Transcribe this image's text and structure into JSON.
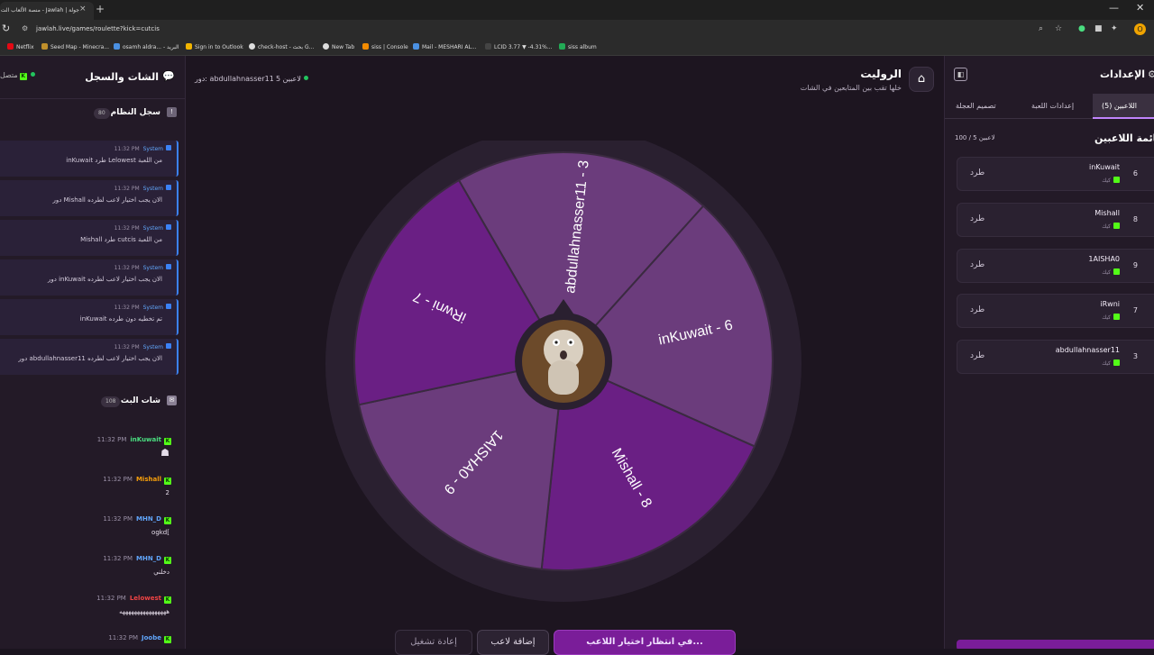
{
  "browser": {
    "tab_title": "جولة | Jawlah - منصة الألعاب الت",
    "tab_close": "×",
    "new_tab": "+",
    "url": "jawlah.live/games/roulette?kick=cutcis",
    "bookmarks": [
      {
        "label": "Netflix",
        "color": "#e50914"
      },
      {
        "label": "Seed Map - Minecra...",
        "color": "#c0902b"
      },
      {
        "label": "osamh aldra... - البريد",
        "color": "#4a90e2"
      },
      {
        "label": "Sign in to Outlook",
        "color": "#f2b500"
      },
      {
        "label": "check-host - بحث G...",
        "color": "#dddddd"
      },
      {
        "label": "New Tab",
        "color": "#dddddd"
      },
      {
        "label": "siss | Console",
        "color": "#f28b00"
      },
      {
        "label": "Mail - MESHARI AL...",
        "color": "#4a90e2"
      },
      {
        "label": "LCID 3.77 ▼ -4.31%...",
        "color": "#444444"
      },
      {
        "label": "siss album",
        "color": "#22aa55"
      }
    ],
    "avatar_letter": "O"
  },
  "chat_panel": {
    "title": "الشات والسجل",
    "status": "متصل",
    "system_log": {
      "title": "سجل النظام",
      "count": "80",
      "messages": [
        {
          "time": "11:32 PM",
          "sender": "System",
          "text": "inKuwait طرد Lelowest من اللعبة"
        },
        {
          "time": "11:32 PM",
          "sender": "System",
          "text": "دور Mishall الان يجب اختيار لاعب لطرده"
        },
        {
          "time": "11:32 PM",
          "sender": "System",
          "text": "Mishall طرد cutcis من اللعبة"
        },
        {
          "time": "11:32 PM",
          "sender": "System",
          "text": "دور inKuwait الان يجب اختيار لاعب لطرده"
        },
        {
          "time": "11:32 PM",
          "sender": "System",
          "text": "inKuwait تم تخطيه دون طرده"
        },
        {
          "time": "11:32 PM",
          "sender": "System",
          "text": "دور abdullahnasser11 الان يجب اختيار لاعب لطرده"
        }
      ]
    },
    "live_chat": {
      "title": "شات البث",
      "count": "108",
      "messages": [
        {
          "time": "11:32 PM",
          "user": "inKuwait",
          "color": "#4ade80",
          "text": "☗"
        },
        {
          "time": "11:32 PM",
          "user": "Mishall",
          "color": "#f59e0b",
          "text": "2"
        },
        {
          "time": "11:32 PM",
          "user": "MHN_D",
          "color": "#60a5fa",
          "text": "ogkd["
        },
        {
          "time": "11:32 PM",
          "user": "MHN_D",
          "color": "#60a5fa",
          "text": "دخلني"
        },
        {
          "time": "11:32 PM",
          "user": "Lelowest",
          "color": "#ef4444",
          "text": "ههههههههههههههههه"
        },
        {
          "time": "11:32 PM",
          "user": "Joobe",
          "color": "#60a5fa",
          "text": ""
        }
      ]
    }
  },
  "game": {
    "turn_label": "دور: abdullahnasser11",
    "players_count": "5 لاعبين",
    "title": "الروليت",
    "subtitle": "خلها تقب بين المتابعين في الشات",
    "wheel_segments": [
      {
        "label": "abdullahnasser11 - 3",
        "color": "#6b3c7c"
      },
      {
        "label": "inKuwait - 6",
        "color": "#6b3c7c"
      },
      {
        "label": "Mishall - 8",
        "color": "#6a1f84"
      },
      {
        "label": "1AISHA0 - 9",
        "color": "#6b3c7c"
      },
      {
        "label": "iRwni - 7",
        "color": "#6a1f84"
      }
    ],
    "buttons": {
      "restart": "إعادة تشغيل",
      "add_player": "إضافة لاعب",
      "waiting": "في انتظار اختيار اللاعب..."
    }
  },
  "settings_panel": {
    "title": "الإعدادات",
    "tabs": [
      "اللاعبين (5)",
      "إعدادات اللعبة",
      "تصميم العجلة"
    ],
    "players_title": "قائمة اللاعبين",
    "players_count": "100 / 5 لاعبين",
    "kick_label": "طرد",
    "source_label": "كيك",
    "players": [
      {
        "name": "inKuwait",
        "number": "6"
      },
      {
        "name": "Mishall",
        "number": "8"
      },
      {
        "name": "1AISHA0",
        "number": "9"
      },
      {
        "name": "iRwni",
        "number": "7"
      },
      {
        "name": "abdullahnasser11",
        "number": "3"
      }
    ]
  }
}
